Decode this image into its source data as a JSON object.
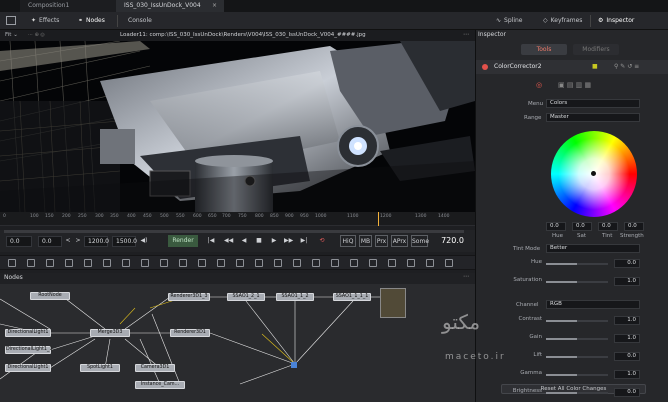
{
  "tabs": {
    "composition": "Composition1",
    "active": "ISS_030_IssUnDock_V004"
  },
  "toolbar": {
    "effects": "Effects",
    "nodes": "Nodes",
    "console": "Console",
    "spline": "Spline",
    "keyframes": "Keyframes",
    "inspector": "Inspector"
  },
  "viewer": {
    "fit": "Fit",
    "title": "Loader11: comp:\\ISS_030_IssUnDock\\Renders\\V004\\ISS_030_IssUnDock_V004_####.jpg"
  },
  "ruler": {
    "ticks": [
      "0",
      "100",
      "150",
      "200",
      "250",
      "300",
      "350",
      "400",
      "450",
      "500",
      "550",
      "600",
      "650",
      "700",
      "750",
      "800",
      "850",
      "900",
      "950",
      "1000",
      "1100",
      "1200",
      "1300",
      "1400"
    ],
    "current_frame": 720
  },
  "transport": {
    "start": "0.0",
    "in": "0.0",
    "end": "1200.0",
    "out": "1500.0",
    "render": "Render",
    "hiq": "HiQ",
    "mb": "MB",
    "prx": "Prx",
    "aprx": "APrx",
    "some": "Some",
    "frame": "720.0"
  },
  "nodes_panel": {
    "title": "Nodes",
    "nodes": {
      "rootnode": "RootNode",
      "dl1": "DirectionalLight1",
      "dl12": "DirectionalLight1_1",
      "dl11": "DirectionalLight1",
      "merge": "Merge3D3",
      "spot": "SpotLight1",
      "camera": "Camera3D1",
      "instance": "Instance_Cam...",
      "r3": "Renderer3D1_3",
      "r1": "Renderer3D1",
      "ssao21": "SSAO1_2_1",
      "ssao12": "SSAO1_1_2",
      "ssao111": "SSAO1_1_1_1"
    }
  },
  "inspector": {
    "title": "Inspector",
    "tab_tools": "Tools",
    "tab_modifiers": "Modifiers",
    "node_name": "ColorCorrector2",
    "menu_label": "Menu",
    "menu_value": "Colors",
    "range_label": "Range",
    "range_value": "Master",
    "wheel": {
      "hue": "0.0",
      "sat": "0.0",
      "tint": "0.0",
      "strength": "0.0",
      "hue_label": "Hue",
      "sat_label": "Sat",
      "tint_label": "Tint",
      "strength_label": "Strength"
    },
    "tint_mode_label": "Tint Mode",
    "tint_mode_value": "Better",
    "params": [
      {
        "label": "Hue",
        "value": "0.0",
        "fill": 0.5
      },
      {
        "label": "Saturation",
        "value": "1.0",
        "fill": 0.5
      }
    ],
    "channel_label": "Channel",
    "channel_value": "RGB",
    "params2": [
      {
        "label": "Contrast",
        "value": "1.0",
        "fill": 0.5
      },
      {
        "label": "Gain",
        "value": "1.0",
        "fill": 0.5
      },
      {
        "label": "Lift",
        "value": "0.0",
        "fill": 0.5
      },
      {
        "label": "Gamma",
        "value": "1.0",
        "fill": 0.5
      },
      {
        "label": "Brightness",
        "value": "0.0",
        "fill": 0.5
      }
    ],
    "reset": "Reset All Color Changes"
  },
  "watermark": {
    "brand": "مکتو",
    "site": "maceto.ir"
  }
}
